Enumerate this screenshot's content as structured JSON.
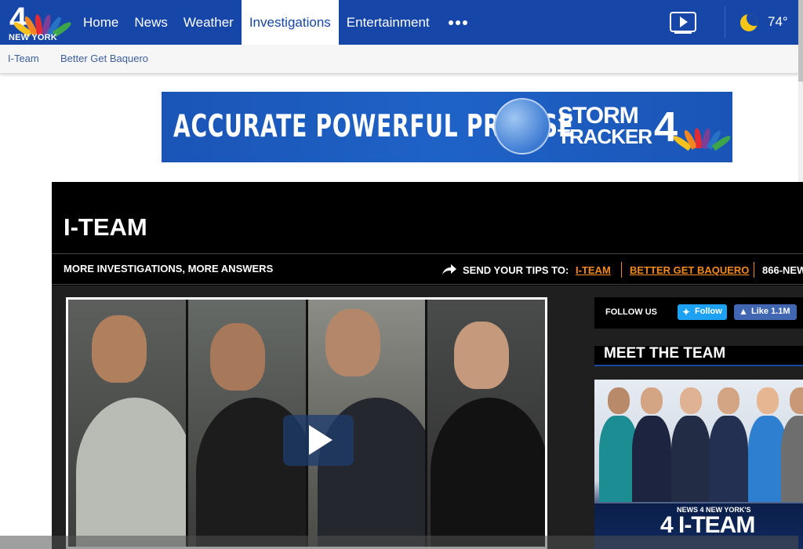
{
  "header": {
    "logo_number": "4",
    "logo_city": "NEW YORK",
    "nav": [
      {
        "label": "Home",
        "active": false
      },
      {
        "label": "News",
        "active": false
      },
      {
        "label": "Weather",
        "active": false
      },
      {
        "label": "Investigations",
        "active": true
      },
      {
        "label": "Entertainment",
        "active": false
      }
    ],
    "more_icon": "more-dots-icon",
    "video_icon": "video-play-icon",
    "weather_icon": "moon-icon",
    "temperature": "74°"
  },
  "subnav": [
    {
      "label": "I-Team"
    },
    {
      "label": "Better Get Baquero"
    }
  ],
  "ad": {
    "tagline": "ACCURATE POWERFUL PRECISE",
    "brand_line1": "STORM",
    "brand_line2": "TRACKER",
    "brand_number": "4"
  },
  "iteam": {
    "title": "I-TEAM",
    "subtitle": "MORE INVESTIGATIONS, MORE ANSWERS",
    "tips_label": "SEND YOUR TIPS TO:",
    "tips_links": [
      "I-TEAM",
      "BETTER GET BAQUERO"
    ],
    "tips_phone": "866-NEW"
  },
  "sidebar": {
    "follow_label": "FOLLOW US",
    "twitter_button": "Follow",
    "facebook_button": "Like 1.1M",
    "meet_title": "MEET THE TEAM",
    "team_banner_top": "NEWS 4 NEW YORK'S",
    "team_banner_main": "4 I-TEAM"
  },
  "colors": {
    "brand_blue": "#1546a8",
    "tip_orange": "#f28a1c",
    "twitter": "#1da1f2",
    "facebook": "#4267b2"
  }
}
